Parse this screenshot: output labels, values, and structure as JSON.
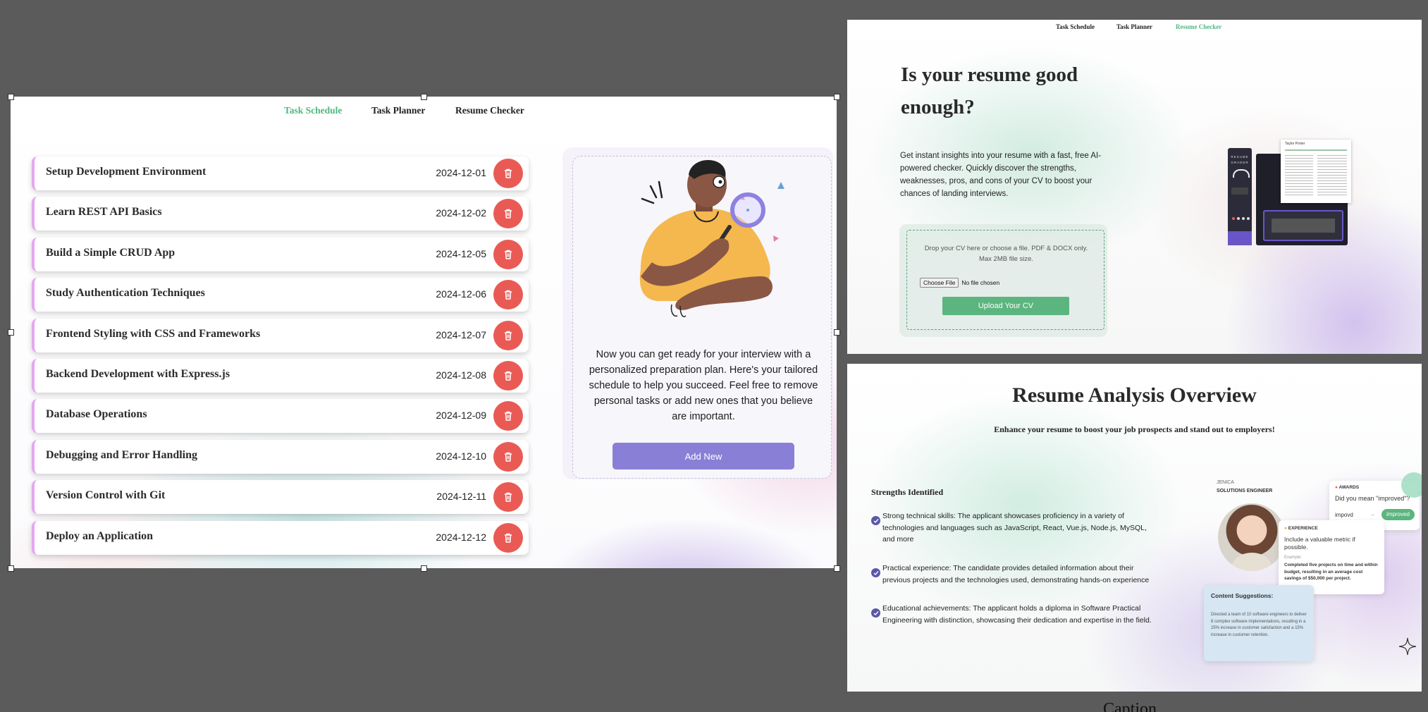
{
  "left_panel": {
    "nav": {
      "task_schedule": "Task Schedule",
      "task_planner": "Task Planner",
      "resume_checker": "Resume Checker"
    },
    "tasks": [
      {
        "title": "Setup Development Environment",
        "date": "2024-12-01"
      },
      {
        "title": "Learn REST API Basics",
        "date": "2024-12-02"
      },
      {
        "title": "Build a Simple CRUD App",
        "date": "2024-12-05"
      },
      {
        "title": "Study Authentication Techniques",
        "date": "2024-12-06"
      },
      {
        "title": "Frontend Styling with CSS and Frameworks",
        "date": "2024-12-07"
      },
      {
        "title": "Backend Development with Express.js",
        "date": "2024-12-08"
      },
      {
        "title": "Database Operations",
        "date": "2024-12-09"
      },
      {
        "title": "Debugging and Error Handling",
        "date": "2024-12-10"
      },
      {
        "title": "Version Control with Git",
        "date": "2024-12-11"
      },
      {
        "title": "Deploy an Application",
        "date": "2024-12-12"
      }
    ],
    "info_text": "Now you can get ready for your interview with a personalized preparation plan. Here's your tailored schedule to help you succeed. Feel free to remove personal tasks or add new ones that you believe are important.",
    "add_new_label": "Add New"
  },
  "top_right": {
    "nav": {
      "task_schedule": "Task Schedule",
      "task_planner": "Task Planner",
      "resume_checker": "Resume Checker"
    },
    "heading": "Is your resume good enough?",
    "description": "Get instant insights into your resume with a fast, free AI-powered checker. Quickly discover the strengths, weaknesses, pros, and cons of your CV to boost your chances of landing interviews.",
    "drop_text": "Drop your CV here or choose a file. PDF & DOCX only. Max 2MB file size.",
    "choose_file_label": "Choose File",
    "no_file_label": "No file chosen",
    "upload_label": "Upload Your CV",
    "grader": {
      "label_1": "RESUME",
      "label_2": "GRADER",
      "paper_name": "Taylor Porter"
    }
  },
  "bottom_right": {
    "title": "Resume Analysis Overview",
    "subtitle": "Enhance your resume to boost your job prospects and stand out to employers!",
    "strengths_heading": "Strengths Identified",
    "strengths": [
      "Strong technical skills: The applicant showcases proficiency in a variety of technologies and languages such as JavaScript, React, Vue.js, Node.js, MySQL, and more",
      "Practical experience: The candidate provides detailed information about their previous projects and the technologies used, demonstrating hands-on experience",
      "Educational achievements: The applicant holds a diploma in Software Practical Engineering with distinction, showcasing their dedication and expertise in the field."
    ],
    "profile": {
      "name": "JENICA",
      "role": "SOLUTIONS ENGINEER"
    },
    "awards_card": {
      "label": "AWARDS",
      "question": "Did you mean \"improved\"?",
      "wrong": "impovd",
      "right": "improved"
    },
    "experience_card": {
      "label": "EXPERIENCE",
      "text": "Include a valuable metric if possible.",
      "example_label": "Example:",
      "example": "Completed five projects on time and within budget, resulting in an average cost savings of $50,000 per project."
    },
    "content_card": {
      "title": "Content Suggestions:",
      "text": "Directed a team of 10 software engineers to deliver 8 complex software implementations, resulting in a 25% increase in customer satisfaction and a 15% increase in customer retention."
    }
  },
  "caption": "Caption",
  "colors": {
    "accent_green": "#4db882",
    "delete_red": "#ea5a55",
    "purple_button": "#8a7fd6",
    "upload_green": "#5cb57f"
  }
}
